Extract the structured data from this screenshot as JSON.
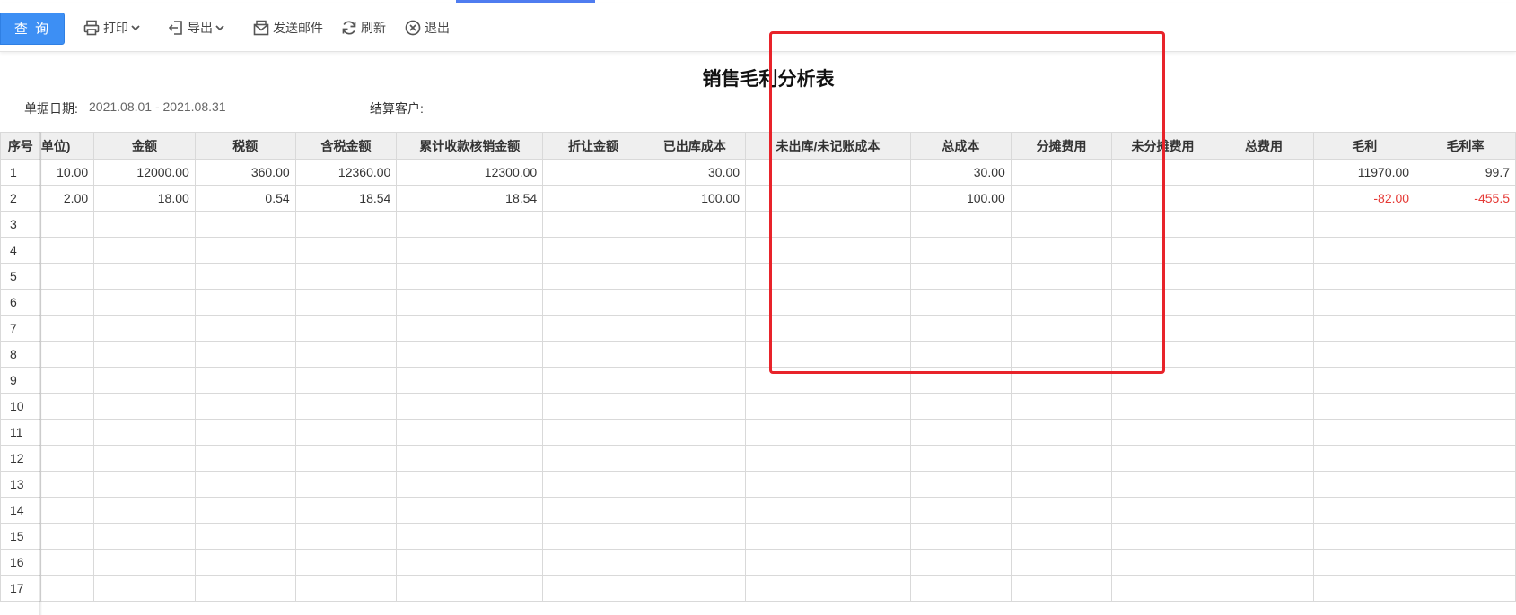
{
  "toolbar": {
    "query_label": "查 询",
    "print_label": "打印",
    "export_label": "导出",
    "email_label": "发送邮件",
    "refresh_label": "刷新",
    "exit_label": "退出"
  },
  "report": {
    "title": "销售毛利分析表",
    "date_label": "单据日期:",
    "date_value": "2021.08.01 - 2021.08.31",
    "customer_label": "结算客户:",
    "customer_value": ""
  },
  "table": {
    "columns": [
      "序号",
      "单位)",
      "金额",
      "税额",
      "含税金额",
      "累计收款核销金额",
      "折让金额",
      "已出库成本",
      "未出库/未记账成本",
      "总成本",
      "分摊费用",
      "未分摊费用",
      "总费用",
      "毛利",
      "毛利率"
    ],
    "rows": [
      [
        "1",
        "10.00",
        "12000.00",
        "360.00",
        "12360.00",
        "12300.00",
        "",
        "30.00",
        "",
        "30.00",
        "",
        "",
        "",
        "11970.00",
        "99.7"
      ],
      [
        "2",
        "2.00",
        "18.00",
        "0.54",
        "18.54",
        "18.54",
        "",
        "100.00",
        "",
        "100.00",
        "",
        "",
        "",
        "-82.00",
        "-455.5"
      ],
      [
        "3",
        "",
        "",
        "",
        "",
        "",
        "",
        "",
        "",
        "",
        "",
        "",
        "",
        "",
        ""
      ],
      [
        "4",
        "",
        "",
        "",
        "",
        "",
        "",
        "",
        "",
        "",
        "",
        "",
        "",
        "",
        ""
      ],
      [
        "5",
        "",
        "",
        "",
        "",
        "",
        "",
        "",
        "",
        "",
        "",
        "",
        "",
        "",
        ""
      ],
      [
        "6",
        "",
        "",
        "",
        "",
        "",
        "",
        "",
        "",
        "",
        "",
        "",
        "",
        "",
        ""
      ],
      [
        "7",
        "",
        "",
        "",
        "",
        "",
        "",
        "",
        "",
        "",
        "",
        "",
        "",
        "",
        ""
      ],
      [
        "8",
        "",
        "",
        "",
        "",
        "",
        "",
        "",
        "",
        "",
        "",
        "",
        "",
        "",
        ""
      ],
      [
        "9",
        "",
        "",
        "",
        "",
        "",
        "",
        "",
        "",
        "",
        "",
        "",
        "",
        "",
        ""
      ],
      [
        "10",
        "",
        "",
        "",
        "",
        "",
        "",
        "",
        "",
        "",
        "",
        "",
        "",
        "",
        ""
      ],
      [
        "11",
        "",
        "",
        "",
        "",
        "",
        "",
        "",
        "",
        "",
        "",
        "",
        "",
        "",
        ""
      ],
      [
        "12",
        "",
        "",
        "",
        "",
        "",
        "",
        "",
        "",
        "",
        "",
        "",
        "",
        "",
        ""
      ],
      [
        "13",
        "",
        "",
        "",
        "",
        "",
        "",
        "",
        "",
        "",
        "",
        "",
        "",
        "",
        ""
      ],
      [
        "14",
        "",
        "",
        "",
        "",
        "",
        "",
        "",
        "",
        "",
        "",
        "",
        "",
        "",
        ""
      ],
      [
        "15",
        "",
        "",
        "",
        "",
        "",
        "",
        "",
        "",
        "",
        "",
        "",
        "",
        "",
        ""
      ],
      [
        "16",
        "",
        "",
        "",
        "",
        "",
        "",
        "",
        "",
        "",
        "",
        "",
        "",
        "",
        ""
      ],
      [
        "17",
        "",
        "",
        "",
        "",
        "",
        "",
        "",
        "",
        "",
        "",
        "",
        "",
        "",
        ""
      ]
    ]
  },
  "colors": {
    "accent": "#3d8ff4",
    "negative": "#e53935",
    "highlight_box": "#e8232a"
  }
}
